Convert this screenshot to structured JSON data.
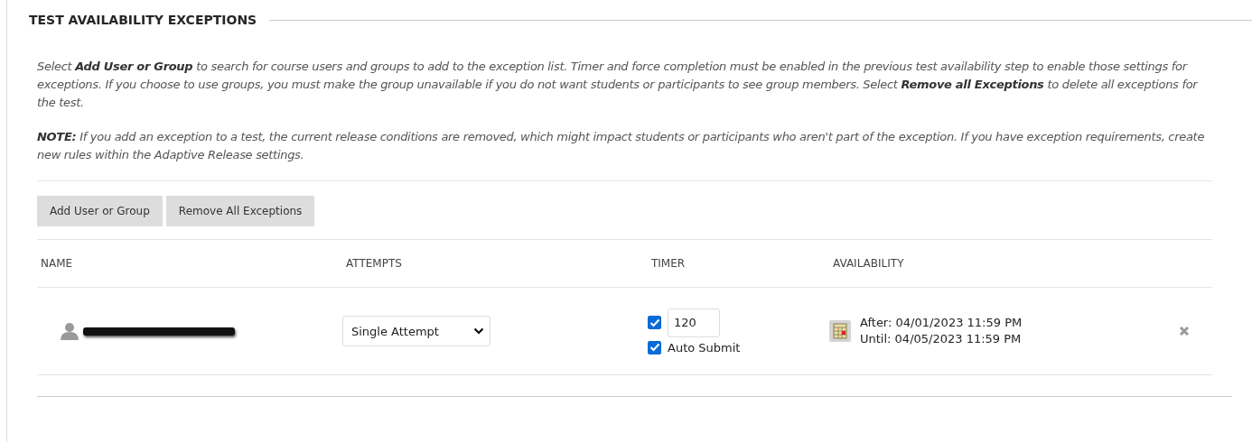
{
  "section": {
    "title": "TEST AVAILABILITY EXCEPTIONS"
  },
  "instructions": [
    "Select **Add User or Group** to search for course users and groups to add to the exception list. Timer and force completion must be enabled in the previous test availability step to enable those settings for exceptions. If you choose to use groups, you must make the group unavailable if you do not want students or participants to see group members. Select **Remove all Exceptions** to delete all exceptions for the test.",
    "**NOTE:** If you add an exception to a test, the current release conditions are removed, which might impact students or participants who aren't part of the exception. If you have exception requirements, create new rules within the Adaptive Release settings."
  ],
  "buttons": [
    "Add User or Group",
    "Remove All Exceptions"
  ],
  "table": {
    "columns": [
      "NAME",
      "ATTEMPTS",
      "TIMER",
      "AVAILABILITY"
    ],
    "rows": [
      {
        "name_redacted": true,
        "attempts": "Single Attempt",
        "timer_enabled": true,
        "timer_minutes": "120",
        "auto_submit": true,
        "auto_submit_label": "Auto Submit",
        "after": "After: 04/01/2023 11:59 PM",
        "until": "Until: 04/05/2023 11:59 PM"
      }
    ]
  }
}
